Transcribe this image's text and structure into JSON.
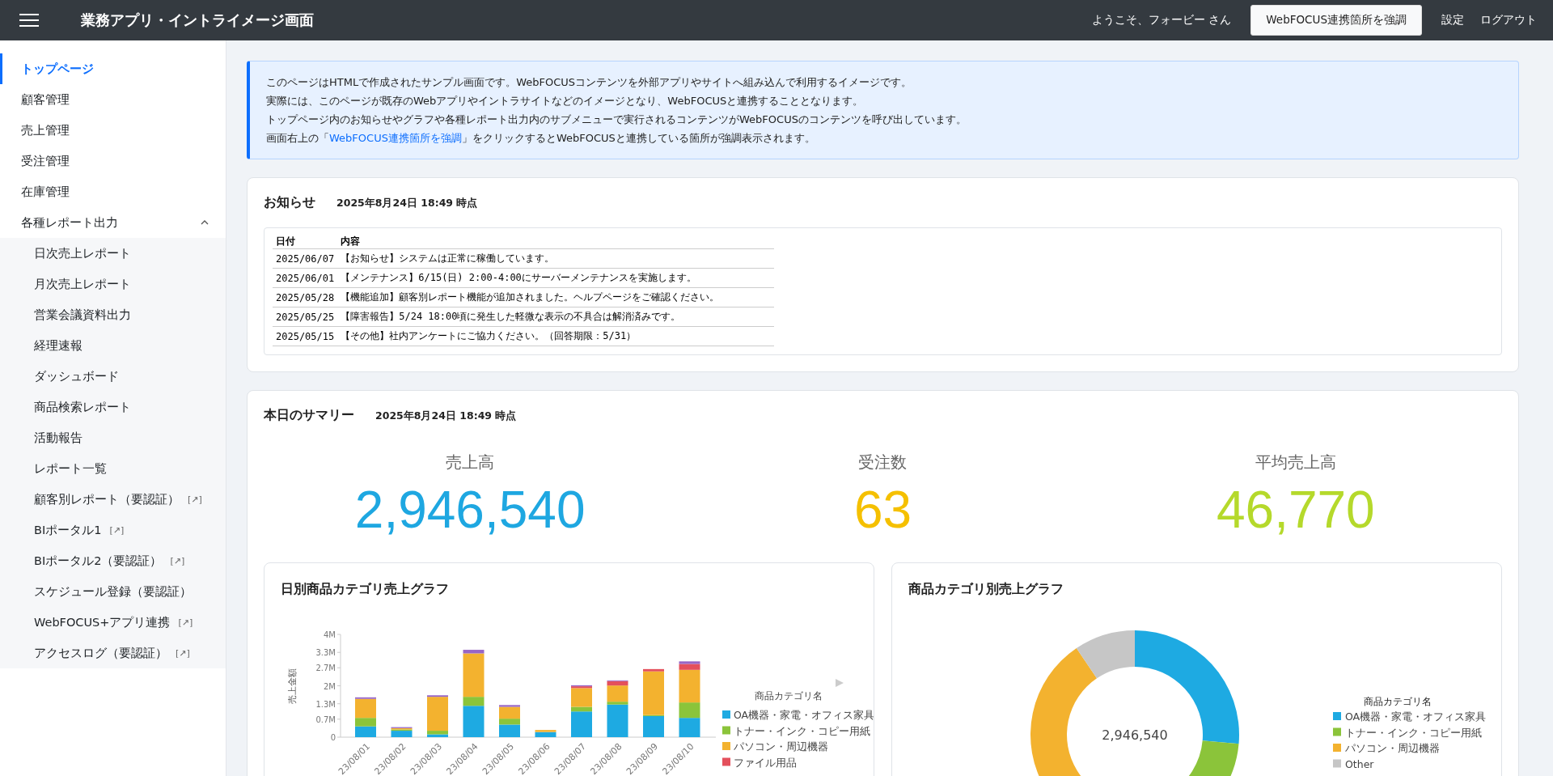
{
  "header": {
    "title": "業務アプリ・イントライメージ画面",
    "welcome": "ようこそ、フォービー さん",
    "highlight_button": "WebFOCUS連携箇所を強調",
    "links": [
      "設定",
      "ログアウト"
    ]
  },
  "sidebar": {
    "items": [
      {
        "label": "トップページ",
        "selected": true
      },
      {
        "label": "顧客管理",
        "selected": false
      },
      {
        "label": "売上管理",
        "selected": false
      },
      {
        "label": "受注管理",
        "selected": false
      },
      {
        "label": "在庫管理",
        "selected": false
      },
      {
        "label": "各種レポート出力",
        "selected": false,
        "expanded": true,
        "children": [
          {
            "label": "日次売上レポート",
            "selected": false
          },
          {
            "label": "月次売上レポート",
            "selected": false
          },
          {
            "label": "営業会議資料出力",
            "selected": false
          },
          {
            "label": "経理速報",
            "selected": false
          },
          {
            "label": "ダッシュボード",
            "selected": false
          },
          {
            "label": "商品検索レポート",
            "selected": false
          },
          {
            "label": "活動報告",
            "selected": false
          },
          {
            "label": "レポート一覧",
            "selected": false
          },
          {
            "label": "顧客別レポート（要認証）",
            "selected": false,
            "badge": "[↗]"
          },
          {
            "label": "BIポータル1",
            "selected": false,
            "badge": "[↗]"
          },
          {
            "label": "BIポータル2（要認証）",
            "selected": false,
            "badge": "[↗]"
          },
          {
            "label": "スケジュール登録（要認証）",
            "selected": false
          },
          {
            "label": "WebFOCUS+アプリ連携",
            "selected": false,
            "badge": "[↗]"
          },
          {
            "label": "アクセスログ（要認証）",
            "selected": false,
            "badge": "[↗]"
          }
        ]
      }
    ]
  },
  "info": {
    "lines": [
      "このページはHTMLで作成されたサンプル画面です。WebFOCUSコンテンツを外部アプリやサイトへ組み込んで利用するイメージです。",
      "実際には、このページが既存のWebアプリやイントラサイトなどのイメージとなり、WebFOCUSと連携することとなります。",
      "トップページ内のお知らせやグラフや各種レポート出力内のサブメニューで実行されるコンテンツがWebFOCUSのコンテンツを呼び出しています。"
    ],
    "last_line": {
      "before": "画面右上の「",
      "link": "WebFOCUS連携箇所を強調",
      "after": "」をクリックするとWebFOCUSと連携している箇所が強調表示されます。"
    }
  },
  "news": {
    "title": "お知らせ",
    "timestamp": "2025年8月24日 18:49 時点",
    "columns": [
      "日付",
      "内容"
    ],
    "rows": [
      [
        "2025/06/07",
        "【お知らせ】システムは正常に稼働しています。"
      ],
      [
        "2025/06/01",
        "【メンテナンス】6/15(日) 2:00-4:00にサーバーメンテナンスを実施します。"
      ],
      [
        "2025/05/28",
        "【機能追加】顧客別レポート機能が追加されました。ヘルプページをご確認ください。"
      ],
      [
        "2025/05/25",
        "【障害報告】5/24 18:00頃に発生した軽微な表示の不具合は解消済みです。"
      ],
      [
        "2025/05/15",
        "【その他】社内アンケートにご協力ください。（回答期限：5/31）"
      ]
    ]
  },
  "summary": {
    "title": "本日のサマリー",
    "timestamp": "2025年8月24日 18:49 時点",
    "kpis": [
      {
        "label": "売上高",
        "value": "2,946,540",
        "color": "#1ea7e1"
      },
      {
        "label": "受注数",
        "value": "63",
        "color": "#f5c000"
      },
      {
        "label": "平均売上高",
        "value": "46,770",
        "color": "#b5d92b"
      }
    ],
    "daily_chart": {
      "title": "日別商品カテゴリ売上グラフ",
      "chart_data": {
        "type": "bar",
        "stacked": true,
        "ylabel": "売上金額",
        "categories": [
          "23/08/01",
          "23/08/02",
          "23/08/03",
          "23/08/04",
          "23/08/05",
          "23/08/06",
          "23/08/07",
          "23/08/08",
          "23/08/09",
          "23/08/10"
        ],
        "ylim": [
          0,
          4000000
        ],
        "yticks": [
          {
            "value": 0,
            "label": "0"
          },
          {
            "value": 700000,
            "label": "0.7M"
          },
          {
            "value": 1300000,
            "label": "1.3M"
          },
          {
            "value": 2000000,
            "label": "2M"
          },
          {
            "value": 2700000,
            "label": "2.7M"
          },
          {
            "value": 3300000,
            "label": "3.3M"
          },
          {
            "value": 4000000,
            "label": "4M"
          }
        ],
        "legend": {
          "title": "商品カテゴリ名"
        },
        "series": [
          {
            "name": "OA機器・家電・オフィス家具",
            "color": "#1eaae2",
            "values": [
              420000,
              250000,
              110000,
              1220000,
              490000,
              200000,
              1000000,
              1270000,
              820000,
              750000
            ]
          },
          {
            "name": "トナー・インク・コピー用紙",
            "color": "#8bc43a",
            "values": [
              330000,
              50000,
              140000,
              350000,
              230000,
              0,
              180000,
              110000,
              40000,
              600000
            ]
          },
          {
            "name": "パソコン・周辺機器",
            "color": "#f3b22f",
            "values": [
              740000,
              50000,
              1320000,
              1690000,
              460000,
              80000,
              730000,
              630000,
              1700000,
              1270000
            ]
          },
          {
            "name": "ファイル用品",
            "color": "#e4505c",
            "values": [
              0,
              0,
              0,
              0,
              0,
              0,
              70000,
              170000,
              90000,
              230000
            ]
          },
          {
            "color": "#9866c6",
            "values": [
              60000,
              40000,
              60000,
              140000,
              70000,
              0,
              40000,
              30000,
              0,
              100000
            ]
          }
        ]
      }
    },
    "category_chart": {
      "title": "商品カテゴリ別売上グラフ",
      "center_label": "2,946,540",
      "legend_title": "商品カテゴリ名",
      "legend": [
        {
          "name": "OA機器・家電・オフィス家具",
          "color": "#1eaae2"
        },
        {
          "name": "トナー・インク・コピー用紙",
          "color": "#8bc43a"
        },
        {
          "name": "パソコン・周辺機器",
          "color": "#f3b22f"
        },
        {
          "name": "Other",
          "color": "#c6c6c6"
        }
      ]
    }
  }
}
